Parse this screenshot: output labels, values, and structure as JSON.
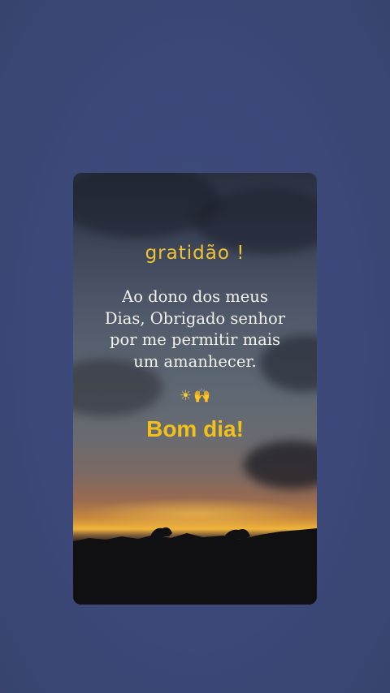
{
  "post": {
    "title": "gratidão !",
    "message_lines": [
      "Ao dono dos meus",
      "Dias, Obrigado senhor",
      "por me permitir mais",
      "um amanhecer."
    ],
    "emojis": {
      "sun": "☀",
      "hands": "🙌"
    },
    "greeting": "Bom dia!"
  },
  "colors": {
    "background": "#3d4a7a",
    "title": "#f2c231",
    "greeting": "#f2c018",
    "message": "#f4f1ea"
  },
  "icons": [
    "sun-icon",
    "raised-hands-icon"
  ]
}
